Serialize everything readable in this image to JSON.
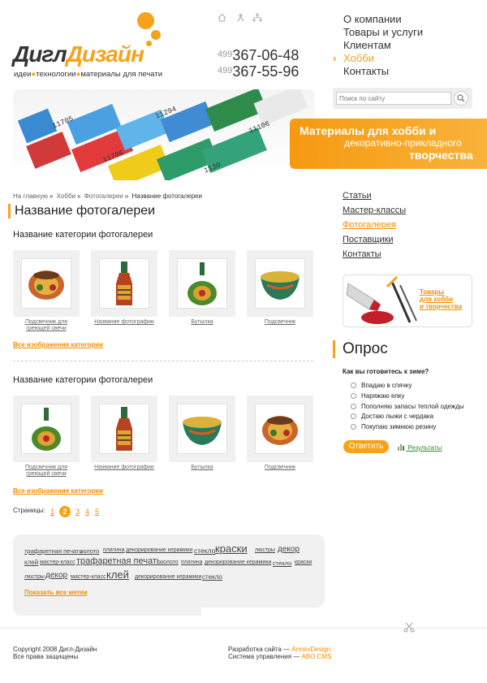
{
  "logo": {
    "part1": "Дигл",
    "part2": "Дизайн",
    "tagline": [
      "идеи",
      "технологии",
      "материалы для печати"
    ]
  },
  "top_icons": [
    "home-icon",
    "feedback-icon",
    "sitemap-icon"
  ],
  "phones": [
    {
      "code": "499",
      "number": "367-06-48"
    },
    {
      "code": "499",
      "number": "367-55-96"
    }
  ],
  "top_menu": [
    "О компании",
    "Товары и услуги",
    "Клиентам",
    "Хобби",
    "Контакты"
  ],
  "top_menu_active": "Хобби",
  "search": {
    "placeholder": "Поиск по сайту"
  },
  "banner": {
    "labels": [
      "11705",
      "11294",
      "11106",
      "11706",
      "1130"
    ]
  },
  "promo": {
    "line1": "Материалы для хобби и",
    "line2": "декоративно-прикладного",
    "line3": "творчества"
  },
  "breadcrumb": {
    "home": "На главную",
    "hobby": "Хобби",
    "photos": "Фотогалереи",
    "current": "Название фотогалереи"
  },
  "gallery_title": "Название фотогалереи",
  "categories": [
    {
      "title": "Название категории фотогалереи",
      "items": [
        "Подсвечник для греющей свечи",
        "Название фотографии",
        "Бутылка",
        "Подсвечник"
      ],
      "all_link": "Все изображения категории"
    },
    {
      "title": "Название категории фотогалереи",
      "items": [
        "Подсвечник для греющей свечи",
        "Название фотографии",
        "Бутылка",
        "Подсвечник"
      ],
      "all_link": "Все изображения категории"
    }
  ],
  "pager": {
    "label": "Страницы:",
    "pages": [
      "1",
      "2",
      "3",
      "4",
      "5"
    ],
    "current": "2"
  },
  "tags": [
    {
      "t": "трафаретная печать",
      "s": 7.5
    },
    {
      "t": "золото",
      "s": 7.5
    },
    {
      "t": "платина",
      "s": 7
    },
    {
      "t": "декорирование керамики",
      "s": 7
    },
    {
      "t": "стекло",
      "s": 8.5
    },
    {
      "t": "краски",
      "s": 13
    },
    {
      "t": "люстры",
      "s": 7
    },
    {
      "t": "декор",
      "s": 10
    },
    {
      "t": "клей",
      "s": 8
    },
    {
      "t": "мастер-класс",
      "s": 7
    },
    {
      "t": "трафаретная печать",
      "s": 11
    },
    {
      "t": "золото",
      "s": 7
    },
    {
      "t": "платина",
      "s": 7
    },
    {
      "t": "декорирование керамики",
      "s": 7
    },
    {
      "t": "стекло",
      "s": 7.5
    },
    {
      "t": "краски",
      "s": 7
    },
    {
      "t": "люстры",
      "s": 7
    },
    {
      "t": "декор",
      "s": 10
    },
    {
      "t": "мастер-класс",
      "s": 7
    },
    {
      "t": "клей",
      "s": 13
    },
    {
      "t": "декорирование керамики",
      "s": 7
    },
    {
      "t": "стекло",
      "s": 8
    }
  ],
  "tags_show_all": "Показать все метки",
  "side_menu": [
    "Статьи",
    "Мастер-классы",
    "Фотогалерея",
    "Поставщики",
    "Контакты"
  ],
  "side_menu_active": "Фотогалерея",
  "hobby_banner": {
    "line1": "Товары",
    "line2": "для хобби",
    "line3": "и творчества"
  },
  "poll": {
    "title": "Опрос",
    "question": "Как вы готовитесь к зиме?",
    "options": [
      "Впадаю в спячку",
      "Наряжаю елку",
      "Пополняю запасы теплой одежды",
      "Достаю лыжи с чердака",
      "Покупаю зимнюю резину"
    ],
    "vote_label": "Ответить",
    "results_label": "Результаты"
  },
  "footer": {
    "copyright": "Copyright 2008 Дигл-Дизайн",
    "rights": "Все права защищены",
    "dev_label": "Разработка сайта —",
    "dev_link": "ArmexDesign",
    "cms_label": "Система управления —",
    "cms_link": "ABO.CMS"
  },
  "colors": {
    "accent": "#f7a21b",
    "link_orange": "#f28c00",
    "text": "#222222"
  }
}
